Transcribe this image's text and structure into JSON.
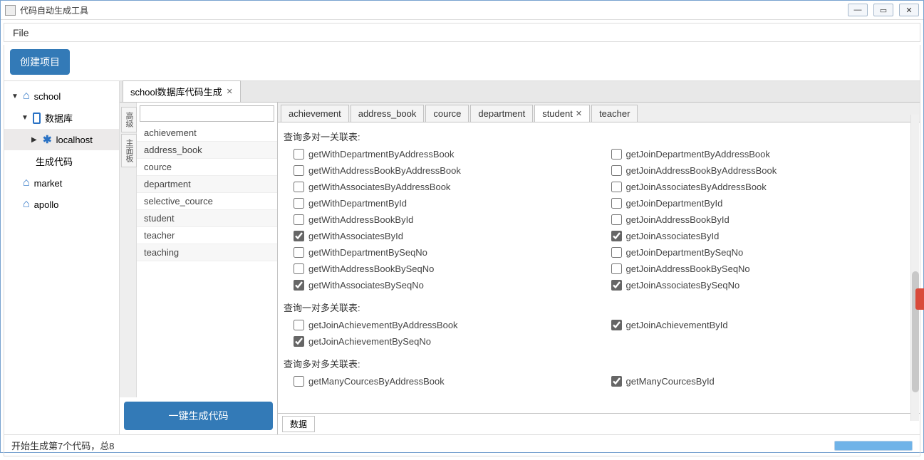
{
  "window": {
    "title": "代码自动生成工具",
    "min": "—",
    "max": "▭",
    "close": "✕"
  },
  "menu": {
    "file": "File"
  },
  "toolbar": {
    "create_project": "创建项目"
  },
  "sidebar": {
    "school": "school",
    "database": "数据库",
    "localhost": "localhost",
    "gen_code": "生成代码",
    "market": "market",
    "apollo": "apollo"
  },
  "main_tab": {
    "label": "school数据库代码生成"
  },
  "side_tabs": {
    "t1": "高级",
    "t2": "主面板"
  },
  "tables": [
    "achievement",
    "address_book",
    "cource",
    "department",
    "selective_cource",
    "student",
    "teacher",
    "teaching"
  ],
  "gen_btn": "一键生成代码",
  "entity_tabs": [
    "achievement",
    "address_book",
    "cource",
    "department",
    "student",
    "teacher"
  ],
  "entity_active_idx": 4,
  "sections": {
    "many_to_one": "查询多对一关联表:",
    "one_to_many": "查询一对多关联表:",
    "many_to_many": "查询多对多关联表:"
  },
  "many_to_one": [
    {
      "l": "getWithDepartmentByAddressBook",
      "lc": false,
      "r": "getJoinDepartmentByAddressBook",
      "rc": false
    },
    {
      "l": "getWithAddressBookByAddressBook",
      "lc": false,
      "r": "getJoinAddressBookByAddressBook",
      "rc": false
    },
    {
      "l": "getWithAssociatesByAddressBook",
      "lc": false,
      "r": "getJoinAssociatesByAddressBook",
      "rc": false
    },
    {
      "l": "getWithDepartmentById",
      "lc": false,
      "r": "getJoinDepartmentById",
      "rc": false
    },
    {
      "l": "getWithAddressBookById",
      "lc": false,
      "r": "getJoinAddressBookById",
      "rc": false
    },
    {
      "l": "getWithAssociatesById",
      "lc": true,
      "r": "getJoinAssociatesById",
      "rc": true
    },
    {
      "l": "getWithDepartmentBySeqNo",
      "lc": false,
      "r": "getJoinDepartmentBySeqNo",
      "rc": false
    },
    {
      "l": "getWithAddressBookBySeqNo",
      "lc": false,
      "r": "getJoinAddressBookBySeqNo",
      "rc": false
    },
    {
      "l": "getWithAssociatesBySeqNo",
      "lc": true,
      "r": "getJoinAssociatesBySeqNo",
      "rc": true
    }
  ],
  "one_to_many": [
    {
      "l": "getJoinAchievementByAddressBook",
      "lc": false,
      "r": "getJoinAchievementById",
      "rc": true
    },
    {
      "l": "getJoinAchievementBySeqNo",
      "lc": true,
      "r": "",
      "rc": false
    }
  ],
  "many_to_many": [
    {
      "l": "getManyCourcesByAddressBook",
      "lc": false,
      "r": "getManyCourcesById",
      "rc": true
    }
  ],
  "bottom_tab": "数据",
  "status": "开始生成第7个代码，总8"
}
